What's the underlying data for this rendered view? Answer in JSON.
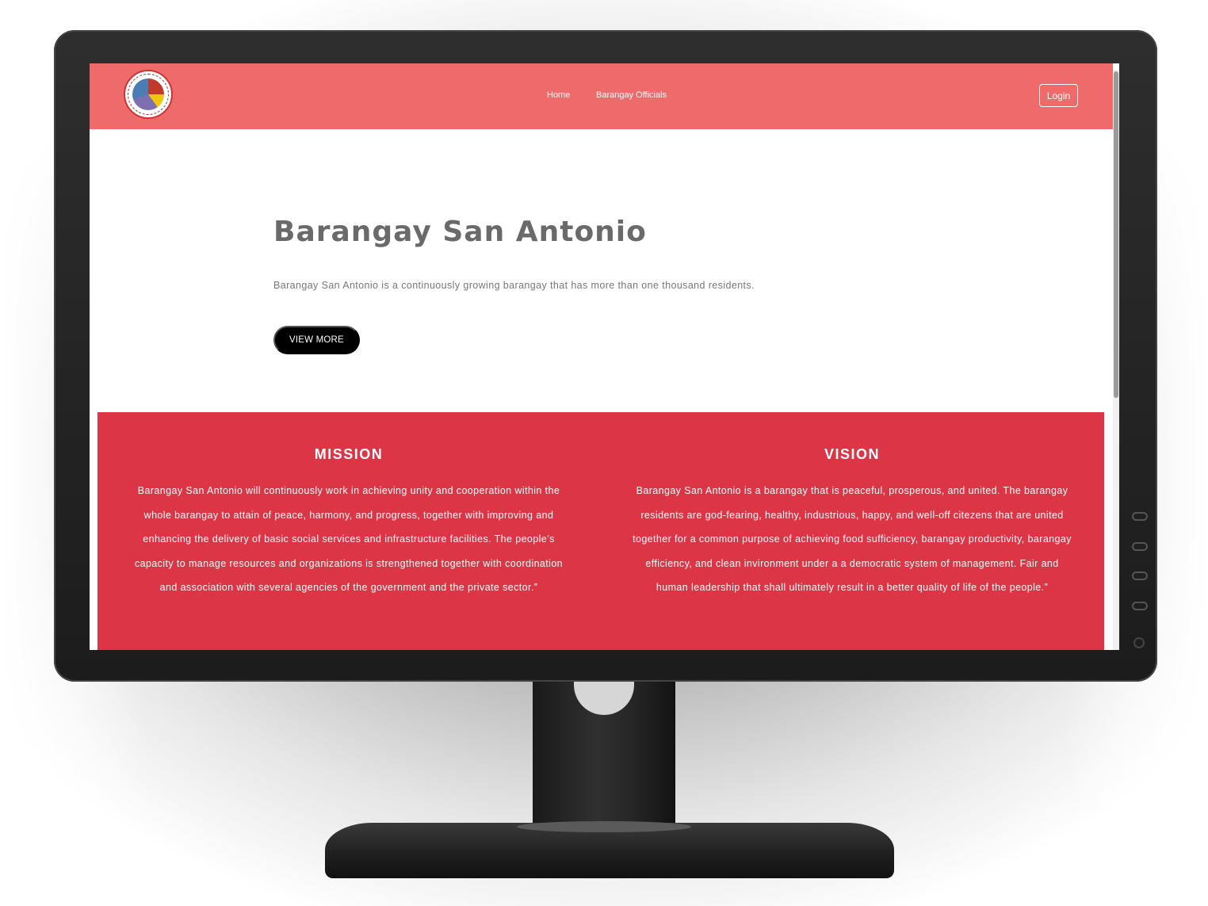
{
  "nav": {
    "links": [
      "Home",
      "Barangay Officials"
    ],
    "login_label": "Login",
    "logo_icon": "municipal-seal-logo"
  },
  "hero": {
    "title": "Barangay San Antonio",
    "description": "Barangay San Antonio is a continuously growing barangay that has more than one thousand residents.",
    "button_label": "VIEW MORE"
  },
  "mission": {
    "title": "MISSION",
    "text": "Barangay San Antonio will continuously work in achieving unity and cooperation within the whole barangay to attain of peace, harmony, and progress, together with improving and enhancing the delivery of basic social services and infrastructure facilities. The people’s capacity to manage resources and organizations is strengthened together with coordination and association with several agencies of the government and the private sector.”"
  },
  "vision": {
    "title": "VISION",
    "text": "Barangay San Antonio is a barangay that is peaceful, prosperous, and united. The barangay residents are god-fearing, healthy, industrious, happy, and well-off citezens that are united together for a common purpose of achieving food sufficiency, barangay productivity, barangay efficiency, and clean invironment under a a democratic system of management. Fair and human leadership that shall ultimately result in a better quality of life of the people.”"
  },
  "colors": {
    "navbar": "#ef6b6b",
    "band": "#dc3545",
    "title_text": "#6a6a6a",
    "button": "#000000"
  }
}
